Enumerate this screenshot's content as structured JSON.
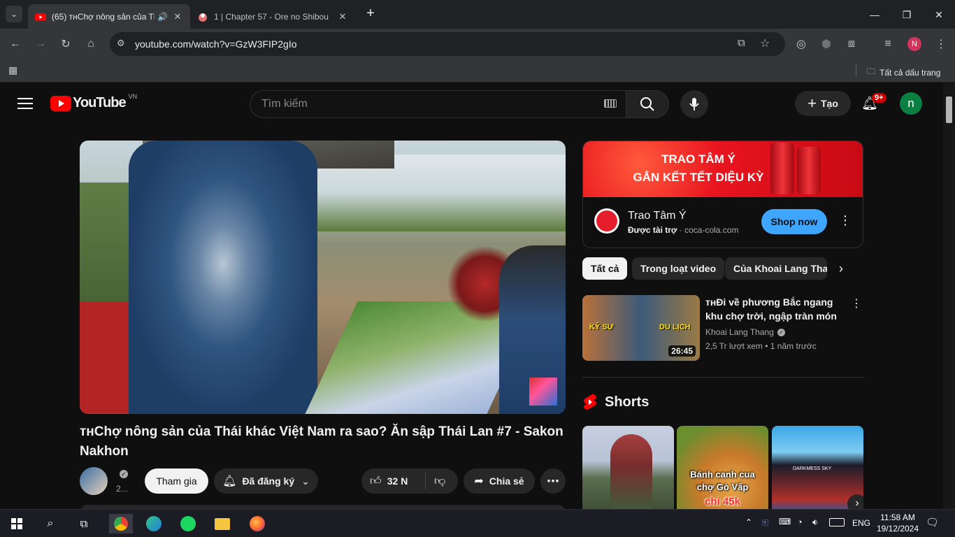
{
  "browser": {
    "tabs": [
      {
        "title": "(65) ᴛʜChợ nông sản của Th",
        "active": true
      },
      {
        "title": "1 | Chapter 57 - Ore no Shibou",
        "active": false
      }
    ],
    "new_tab": "+",
    "url": "youtube.com/watch?v=GzW3FIP2gIo",
    "profile_initial": "N",
    "bookmarks_all": "Tất cả dấu trang"
  },
  "youtube": {
    "logo_text": "YouTube",
    "region": "VN",
    "search_placeholder": "Tìm kiếm",
    "create_label": "Tạo",
    "notif_badge": "9+",
    "avatar_initial": "n",
    "video": {
      "title": "ᴛʜChợ nông sản của Thái khác Việt Nam ra sao? Ăn sập Thái Lan #7 - Sakon Nakhon",
      "channel_sub_count": "2...",
      "join_label": "Tham gia",
      "subscribed_label": "Đã đăng ký",
      "likes": "32 N",
      "share_label": "Chia sẻ"
    },
    "ad": {
      "banner_line1": "TRAO TÂM Ý",
      "banner_line2": "GẮN KẾT TẾT DIỆU KỲ",
      "name": "Trao Tâm Ý",
      "sponsored": "Được tài trợ",
      "domain": "coca-cola.com",
      "cta": "Shop now"
    },
    "chips": [
      "Tất cả",
      "Trong loạt video",
      "Của Khoai Lang Thang"
    ],
    "recommended": {
      "title": "ᴛʜĐi về phương Bắc ngang khu chợ trời, ngập tràn món ăn |Ăn...",
      "channel": "Khoai Lang Thang",
      "views": "2,5 Tr lượt xem",
      "age": "1 năm trước",
      "duration": "26:45",
      "thumb_label_left": "KỸ SƯ",
      "thumb_label_right": "DU LỊCH"
    },
    "shorts_title": "Shorts",
    "shorts": [
      {
        "text": ""
      },
      {
        "text_line1": "Bánh canh cua",
        "text_line2": "chợ Gò Vấp",
        "text_line3": "chỉ 45k"
      },
      {
        "text": "DARKMESS SKY"
      }
    ]
  },
  "taskbar": {
    "lang": "ENG",
    "time": "11:58 AM",
    "date": "19/12/2024"
  },
  "colors": {
    "yt_red": "#ff0000",
    "bg": "#0f0f0f",
    "cta_blue": "#3ea6ff",
    "avatar_green": "#0b8043"
  }
}
